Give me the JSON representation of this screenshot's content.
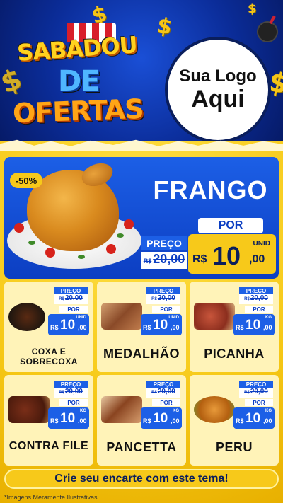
{
  "header": {
    "title_line1": "SABADOU",
    "title_line2": "DE",
    "title_line3": "OFERTAS",
    "logo_line1": "Sua Logo",
    "logo_line2": "Aqui",
    "decor_icons": [
      "dollar-icon",
      "bomb-icon"
    ]
  },
  "hero": {
    "discount": "-50%",
    "name": "FRANGO",
    "por_label": "POR",
    "preco_label": "PREÇO",
    "old_currency": "R$",
    "old_value": "20,00",
    "new_currency": "R$",
    "new_value": "10",
    "new_cents": ",00",
    "unit": "UNID"
  },
  "products": [
    {
      "name": "COXA E SOBRECOXA",
      "preco_label": "PREÇO",
      "old_currency": "R$",
      "old_value": "20,00",
      "por_label": "POR",
      "currency": "R$",
      "value": "10",
      "cents": ",00",
      "unit": "UNID"
    },
    {
      "name": "MEDALHÃO",
      "preco_label": "PREÇO",
      "old_currency": "R$",
      "old_value": "20,00",
      "por_label": "POR",
      "currency": "R$",
      "value": "10",
      "cents": ",00",
      "unit": "UNID"
    },
    {
      "name": "PICANHA",
      "preco_label": "PREÇO",
      "old_currency": "R$",
      "old_value": "20,00",
      "por_label": "POR",
      "currency": "R$",
      "value": "10",
      "cents": ",00",
      "unit": "KG"
    },
    {
      "name": "CONTRA FILE",
      "preco_label": "PREÇO",
      "old_currency": "R$",
      "old_value": "20,00",
      "por_label": "POR",
      "currency": "R$",
      "value": "10",
      "cents": ",00",
      "unit": "KG"
    },
    {
      "name": "PANCETTA",
      "preco_label": "PREÇO",
      "old_currency": "R$",
      "old_value": "20,00",
      "por_label": "POR",
      "currency": "R$",
      "value": "10",
      "cents": ",00",
      "unit": "KG"
    },
    {
      "name": "PERU",
      "preco_label": "PREÇO",
      "old_currency": "R$",
      "old_value": "20,00",
      "por_label": "POR",
      "currency": "R$",
      "value": "10",
      "cents": ",00",
      "unit": "KG"
    }
  ],
  "footer": {
    "cta": "Crie seu encarte com este tema!",
    "disclaimer": "*Imagens Meramente Ilustrativas"
  },
  "colors": {
    "header_blue": "#0b2d9a",
    "accent_yellow": "#f7c91a",
    "price_blue": "#1c5fe6",
    "card_bg": "#fff3b8"
  }
}
